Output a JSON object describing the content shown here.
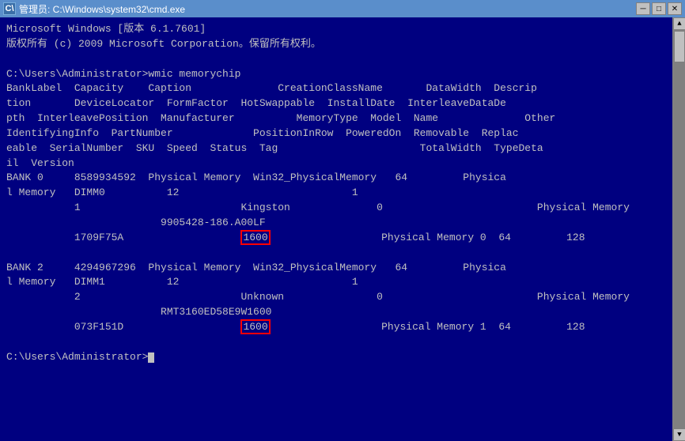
{
  "titlebar": {
    "icon_label": "C:\\",
    "title": "管理员: C:\\Windows\\system32\\cmd.exe",
    "minimize_label": "─",
    "maximize_label": "□",
    "close_label": "✕"
  },
  "console": {
    "lines": [
      "Microsoft Windows [版本 6.1.7601]",
      "版权所有 (c) 2009 Microsoft Corporation。保留所有权利。",
      "",
      "C:\\Users\\Administrator>wmic memorychip",
      "BankLabel  Capacity    Caption              CreationClassName       DataWidth  Descrip",
      "tion       DeviceLocator  FormFactor  HotSwappable  InstallDate  InterleaveDataDe",
      "pth  InterleavePosition  Manufacturer          MemoryType  Model  Name              Other",
      "IdentifyingInfo  PartNumber             PositionInRow  PoweredOn  Removable  Replac",
      "eable  SerialNumber  SKU  Speed  Status  Tag                       TotalWidth  TypeDeta",
      "il  Version",
      "BANK 0     8589934592  Physical Memory  Win32_PhysicalMemory   64         Physica",
      "l Memory   DIMM0          12                            1",
      "           1                          Kingston              0                         Physical Memory",
      "                         9905428-186.A00LF",
      "           1709F75A                   1600                  Physical Memory 0  64         128",
      "",
      "BANK 2     4294967296  Physical Memory  Win32_PhysicalMemory   64         Physica",
      "l Memory   DIMM1          12                            1",
      "           2                          Unknown               0                         Physical Memory",
      "                         RMT3160ED58E9W1600",
      "           073F151D                   1600                  Physical Memory 1  64         128",
      "",
      "C:\\Users\\Administrator>"
    ],
    "highlight1_text": "1600",
    "highlight2_text": "1600"
  }
}
